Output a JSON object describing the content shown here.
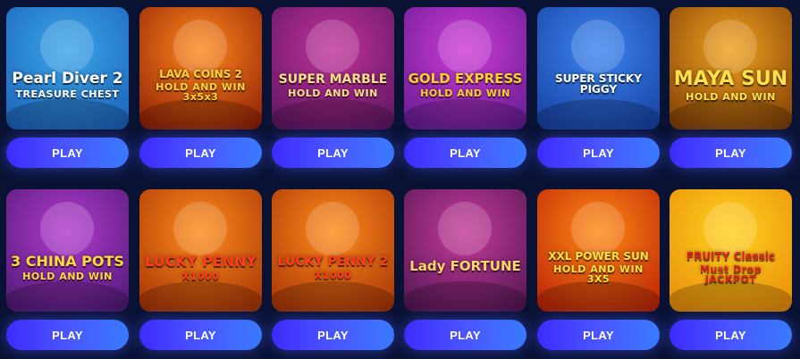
{
  "games": [
    {
      "title": "Pearl Diver 2",
      "subtitle": "TREASURE CHEST",
      "play_label": "PLAY",
      "colors": [
        "#3aa6e8",
        "#1b5fb8"
      ],
      "title_color": "#ffffff",
      "icon": "diver-icon"
    },
    {
      "title": "LAVA COINS 2",
      "subtitle": "HOLD AND WIN 3x5x3",
      "play_label": "PLAY",
      "colors": [
        "#ff8a1c",
        "#8a1a05"
      ],
      "title_color": "#ffd23a",
      "icon": "volcano-icon"
    },
    {
      "title": "SUPER MARBLE",
      "subtitle": "HOLD AND WIN",
      "play_label": "PLAY",
      "colors": [
        "#c2339a",
        "#5a1460"
      ],
      "title_color": "#ffe08a",
      "icon": "marble-icon"
    },
    {
      "title": "GOLD EXPRESS",
      "subtitle": "HOLD AND WIN",
      "play_label": "PLAY",
      "colors": [
        "#d13bd6",
        "#5e1a8e"
      ],
      "title_color": "#ffcf2e",
      "icon": "train-icon"
    },
    {
      "title": "SUPER STICKY PIGGY",
      "subtitle": "",
      "play_label": "PLAY",
      "colors": [
        "#3b86f0",
        "#163d9e"
      ],
      "title_color": "#ffffff",
      "icon": "piggy-icon"
    },
    {
      "title": "MAYA SUN",
      "subtitle": "HOLD AND WIN",
      "play_label": "PLAY",
      "colors": [
        "#f2a21e",
        "#7a3a06"
      ],
      "title_color": "#ffe14a",
      "icon": "maya-mask-icon"
    },
    {
      "title": "3 CHINA POTS",
      "subtitle": "HOLD AND WIN",
      "play_label": "PLAY",
      "colors": [
        "#b43bd0",
        "#4a1870"
      ],
      "title_color": "#ffd93a",
      "icon": "pots-icon"
    },
    {
      "title": "LUCKY PENNY",
      "subtitle": "X1000",
      "play_label": "PLAY",
      "colors": [
        "#ff8c1a",
        "#a33006"
      ],
      "title_color": "#ff3c1e",
      "icon": "leprechaun-icon"
    },
    {
      "title": "LUCKY PENNY 2",
      "subtitle": "X1000",
      "play_label": "PLAY",
      "colors": [
        "#ff8c1a",
        "#a33006"
      ],
      "title_color": "#ff3c1e",
      "icon": "leprechaun-icon"
    },
    {
      "title": "Lady FORTUNE",
      "subtitle": "",
      "play_label": "PLAY",
      "colors": [
        "#c63a9a",
        "#4e1550"
      ],
      "title_color": "#ffd66b",
      "icon": "lady-icon"
    },
    {
      "title": "XXL POWER SUN",
      "subtitle": "HOLD AND WIN 3X5",
      "play_label": "PLAY",
      "colors": [
        "#ff8a14",
        "#b81e06"
      ],
      "title_color": "#ffe23a",
      "icon": "sun-icon"
    },
    {
      "title": "FRUITY Classic",
      "subtitle": "Must Drop JACKPOT",
      "play_label": "PLAY",
      "colors": [
        "#ffd21e",
        "#e88a0a"
      ],
      "title_color": "#e0241c",
      "icon": "seven-icon"
    }
  ]
}
